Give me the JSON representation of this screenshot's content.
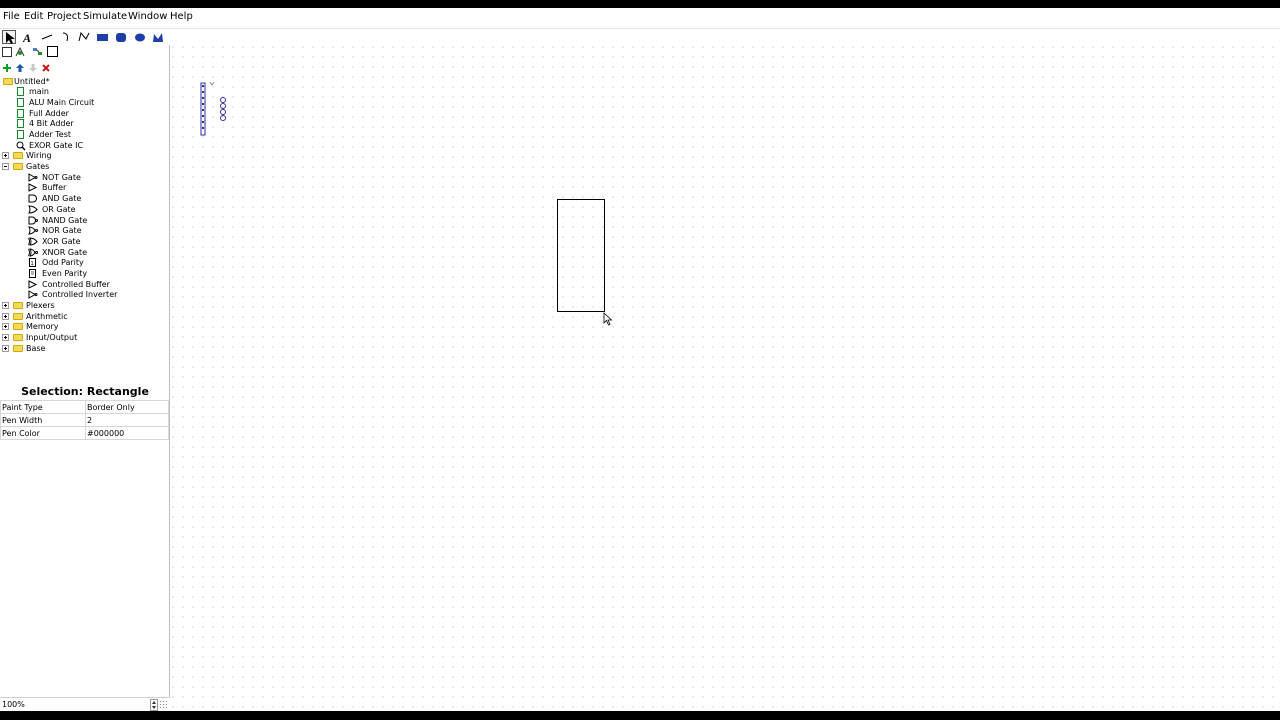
{
  "menu": {
    "file": "File",
    "edit": "Edit",
    "project": "Project",
    "simulate": "Simulate",
    "window": "Window",
    "help": "Help"
  },
  "toolbar": {
    "tools": [
      "select-tool-icon",
      "text-tool-icon",
      "line-tool-icon",
      "curve-tool-icon",
      "polyline-tool-icon",
      "rectangle-tool-icon",
      "rounded-rectangle-tool-icon",
      "oval-tool-icon",
      "polygon-tool-icon"
    ],
    "accent": "#1f3fa6"
  },
  "project": {
    "name": "Untitled*",
    "circuits": [
      "main",
      "ALU Main Circuit",
      "Full Adder",
      "4 Bit Adder",
      "Adder Test",
      "EXOR Gate IC"
    ],
    "libraries": [
      {
        "name": "Wiring",
        "expanded": false
      },
      {
        "name": "Gates",
        "expanded": true,
        "items": [
          "NOT Gate",
          "Buffer",
          "AND Gate",
          "OR Gate",
          "NAND Gate",
          "NOR Gate",
          "XOR Gate",
          "XNOR Gate",
          "Odd Parity",
          "Even Parity",
          "Controlled Buffer",
          "Controlled Inverter"
        ]
      },
      {
        "name": "Plexers",
        "expanded": false
      },
      {
        "name": "Arithmetic",
        "expanded": false
      },
      {
        "name": "Memory",
        "expanded": false
      },
      {
        "name": "Input/Output",
        "expanded": false
      },
      {
        "name": "Base",
        "expanded": false
      }
    ]
  },
  "properties": {
    "title": "Selection: Rectangle",
    "rows": [
      {
        "label": "Paint Type",
        "value": "Border Only"
      },
      {
        "label": "Pen Width",
        "value": "2"
      },
      {
        "label": "Pen Color",
        "value": "#000000"
      }
    ]
  },
  "zoom": "100%",
  "colors": {
    "circuit_icon": "#14872d",
    "delete_icon": "#c21e1e",
    "add_icon": "#139b28",
    "folder": "#f6da54"
  }
}
